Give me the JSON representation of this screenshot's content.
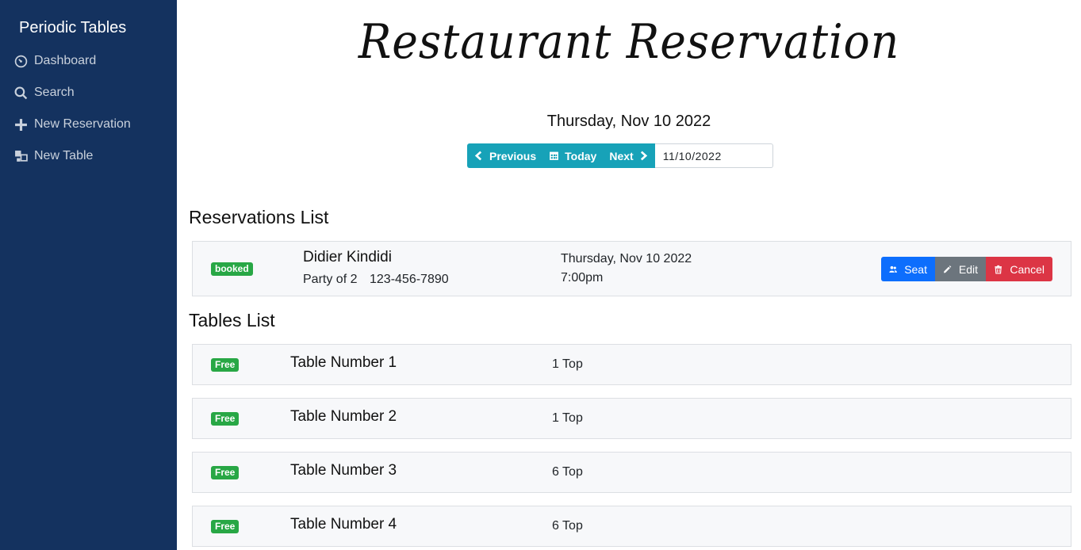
{
  "sidebar": {
    "brand": "Periodic Tables",
    "items": [
      {
        "label": "Dashboard",
        "icon": "dashboard-icon"
      },
      {
        "label": "Search",
        "icon": "search-icon"
      },
      {
        "label": "New Reservation",
        "icon": "plus-icon"
      },
      {
        "label": "New Table",
        "icon": "table-icon"
      }
    ]
  },
  "header": {
    "title": "Restaurant Reservation",
    "date": "Thursday, Nov 10 2022"
  },
  "date_nav": {
    "previous": "Previous",
    "today": "Today",
    "next": "Next",
    "date_value": "11/10/2022",
    "accent": "#17a2b8"
  },
  "reservations": {
    "title": "Reservations List",
    "items": [
      {
        "status": "booked",
        "name": "Didier Kindidi",
        "party": "Party of 2",
        "phone": "123-456-7890",
        "date": "Thursday, Nov 10 2022",
        "time": "7:00pm",
        "actions": {
          "seat": "Seat",
          "edit": "Edit",
          "cancel": "Cancel"
        }
      }
    ]
  },
  "tables": {
    "title": "Tables List",
    "items": [
      {
        "status": "Free",
        "name": "Table Number 1",
        "capacity": "1 Top"
      },
      {
        "status": "Free",
        "name": "Table Number 2",
        "capacity": "1 Top"
      },
      {
        "status": "Free",
        "name": "Table Number 3",
        "capacity": "6 Top"
      },
      {
        "status": "Free",
        "name": "Table Number 4",
        "capacity": "6 Top"
      }
    ]
  },
  "colors": {
    "sidebar_bg": "#14325f",
    "free_badge": "#28a745",
    "seat": "#0d6efd",
    "edit": "#6c757d",
    "cancel": "#dc3545"
  }
}
